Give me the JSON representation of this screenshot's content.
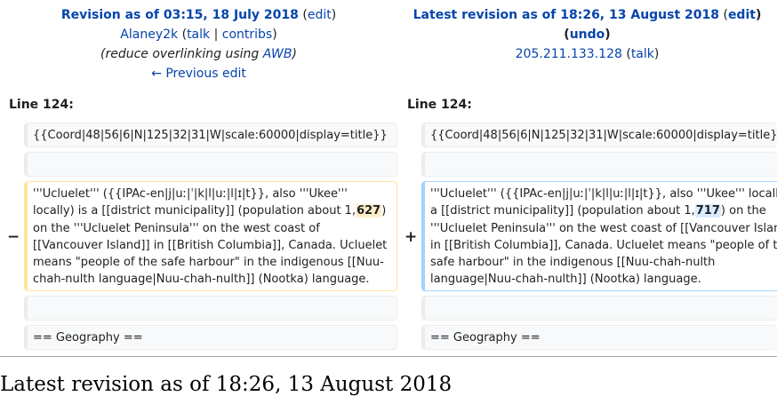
{
  "left_header": {
    "title": "Revision as of 03:15, 18 July 2018",
    "edit": "edit",
    "user": "Alaney2k",
    "talk": "talk",
    "contribs": "contribs",
    "summary_pre": "(reduce overlinking using ",
    "summary_link": "AWB",
    "summary_post": ")",
    "prev_edit": "← Previous edit"
  },
  "right_header": {
    "title": "Latest revision as of 18:26, 13 August 2018",
    "edit": "edit",
    "undo": "undo",
    "user": "205.211.133.128",
    "talk": "talk"
  },
  "diff": {
    "line_left": "Line 124:",
    "line_right": "Line 124:",
    "coord": "{{Coord|48|56|6|N|125|32|31|W|scale:60000|display=title}}",
    "removed_marker": "−",
    "added_marker": "+",
    "para_before": "'''Ucluelet''' ({{IPAc-en|j|uː|ˈ|k|l|uː|l|ɪ|t}}, also '''Ukee''' locally) is a [[district municipality]] (population about 1,",
    "removed_value": "627",
    "added_value": "717",
    "para_after": ") on the '''Ucluelet Peninsula''' on the west coast of [[Vancouver Island]] in [[British Columbia]], Canada. Ucluelet means \"people of the safe harbour\" in the indigenous [[Nuu-chah-nulth language|Nuu-chah-nulth]] (Nootka) language.",
    "geography": "== Geography =="
  },
  "page_heading": "Latest revision as of 18:26, 13 August 2018"
}
